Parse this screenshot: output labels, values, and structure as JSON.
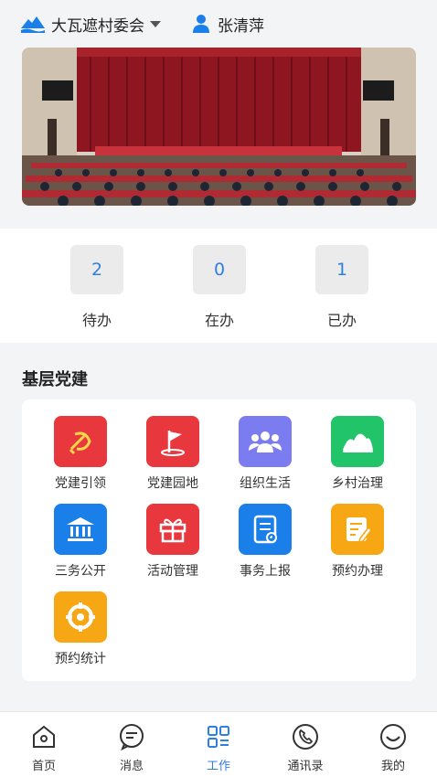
{
  "header": {
    "org_name": "大瓦遮村委会",
    "user_name": "张清萍"
  },
  "stats": [
    {
      "value": "2",
      "label": "待办"
    },
    {
      "value": "0",
      "label": "在办"
    },
    {
      "value": "1",
      "label": "已办"
    }
  ],
  "section": {
    "title": "基层党建",
    "items": [
      {
        "label": "党建引领",
        "icon": "party-flag-icon",
        "color": "#e8373d"
      },
      {
        "label": "党建园地",
        "icon": "party-garden-icon",
        "color": "#e8373d"
      },
      {
        "label": "组织生活",
        "icon": "people-group-icon",
        "color": "#7b7cf0"
      },
      {
        "label": "乡村治理",
        "icon": "mountain-icon",
        "color": "#22c46a"
      },
      {
        "label": "三务公开",
        "icon": "bank-icon",
        "color": "#1a7fe8"
      },
      {
        "label": "活动管理",
        "icon": "gift-icon",
        "color": "#e8373d"
      },
      {
        "label": "事务上报",
        "icon": "report-doc-icon",
        "color": "#1a7fe8"
      },
      {
        "label": "预约办理",
        "icon": "edit-doc-icon",
        "color": "#f7a614"
      },
      {
        "label": "预约统计",
        "icon": "target-icon",
        "color": "#f7a614"
      }
    ]
  },
  "tabbar": [
    {
      "label": "首页",
      "icon": "home-icon"
    },
    {
      "label": "消息",
      "icon": "message-icon"
    },
    {
      "label": "工作",
      "icon": "work-grid-icon",
      "active": true
    },
    {
      "label": "通讯录",
      "icon": "phone-icon"
    },
    {
      "label": "我的",
      "icon": "smile-icon"
    }
  ],
  "colors": {
    "accent": "#2f7fe3",
    "party_red": "#e8373d"
  }
}
